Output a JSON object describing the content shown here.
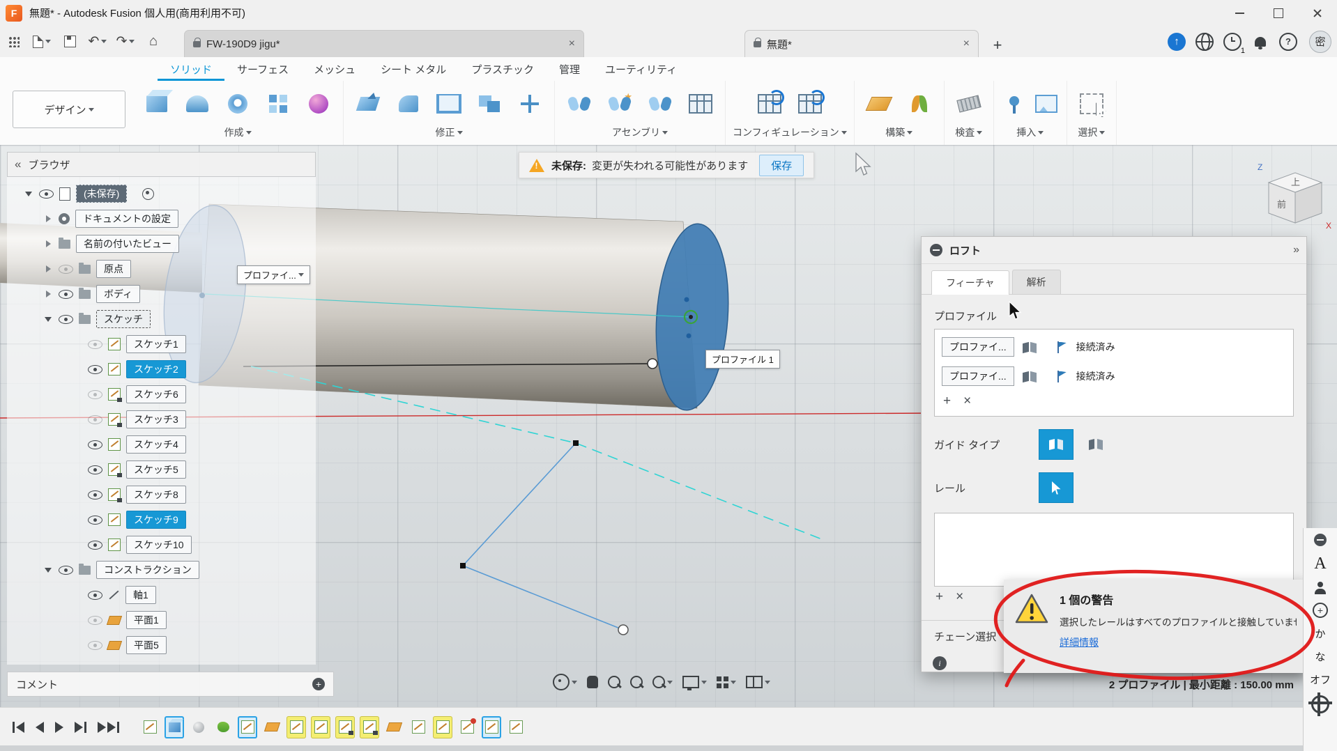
{
  "title_bar": {
    "app_title": "無題* - Autodesk Fusion 個人用(商用利用不可)"
  },
  "quick_toolbar": {
    "left_icons": [
      "app-grid",
      "file-menu",
      "save",
      "undo",
      "redo",
      "home"
    ],
    "doc_tabs": [
      {
        "label": "FW-190D9 jigu*"
      },
      {
        "label": "無題*"
      }
    ],
    "right_icons": [
      "new-tab",
      "job-status",
      "web",
      "time",
      "notifications",
      "help"
    ],
    "notification_count": "1",
    "avatar_initial": "密"
  },
  "ribbon": {
    "workspace_label": "デザイン",
    "tabs": [
      {
        "label": "ソリッド"
      },
      {
        "label": "サーフェス"
      },
      {
        "label": "メッシュ"
      },
      {
        "label": "シート メタル"
      },
      {
        "label": "プラスチック"
      },
      {
        "label": "管理"
      },
      {
        "label": "ユーティリティ"
      }
    ],
    "groups": [
      {
        "label": "作成",
        "tools": [
          "extrude",
          "revolve",
          "hole",
          "pattern",
          "form"
        ]
      },
      {
        "label": "修正",
        "tools": [
          "press-pull",
          "fillet",
          "shell",
          "combine",
          "move"
        ]
      },
      {
        "label": "アセンブリ",
        "tools": [
          "assemble",
          "new-component",
          "joint",
          "parts-table"
        ]
      },
      {
        "label": "コンフィギュレーション",
        "tools": [
          "configure",
          "configuration-table"
        ]
      },
      {
        "label": "構築",
        "tools": [
          "construction-plane",
          "construction-axis"
        ]
      },
      {
        "label": "検査",
        "tools": [
          "measure"
        ]
      },
      {
        "label": "挿入",
        "tools": [
          "insert",
          "canvas"
        ]
      },
      {
        "label": "選択",
        "tools": [
          "select"
        ]
      }
    ]
  },
  "unsaved_bar": {
    "label": "未保存:",
    "message": "変更が失われる可能性があります",
    "save_button": "保存"
  },
  "browser": {
    "title": "ブラウザ",
    "items": [
      {
        "label": "(未保存)"
      },
      {
        "label": "ドキュメントの設定"
      },
      {
        "label": "名前の付いたビュー"
      },
      {
        "label": "原点"
      },
      {
        "label": "ボディ"
      },
      {
        "label": "スケッチ"
      },
      {
        "label": "スケッチ1"
      },
      {
        "label": "スケッチ2"
      },
      {
        "label": "スケッチ6"
      },
      {
        "label": "スケッチ3"
      },
      {
        "label": "スケッチ4"
      },
      {
        "label": "スケッチ5"
      },
      {
        "label": "スケッチ8"
      },
      {
        "label": "スケッチ9"
      },
      {
        "label": "スケッチ10"
      },
      {
        "label": "コンストラクション"
      },
      {
        "label": "軸1"
      },
      {
        "label": "平面1"
      },
      {
        "label": "平面5"
      }
    ]
  },
  "viewport": {
    "profile_dropdown_label": "プロファイ...",
    "profile_tag_label": "プロファイル 1",
    "viewcube_top": "上",
    "viewcube_front": "前"
  },
  "loft_dialog": {
    "title": "ロフト",
    "tab_feature": "フィーチャ",
    "tab_analysis": "解析",
    "profiles_section": "プロファイル",
    "profile_rows": [
      {
        "name": "プロファイ...",
        "status": "接続済み"
      },
      {
        "name": "プロファイ...",
        "status": "接続済み"
      }
    ],
    "guide_type_label": "ガイド タイプ",
    "rail_label": "レール",
    "chain_select_label": "チェーン選択",
    "warning": {
      "title": "1 個の警告",
      "message": "選択したレールはすべてのプロファイルと接触していません。",
      "details_link": "詳細情報"
    }
  },
  "status_bar": {
    "comment_label": "コメント",
    "selection_info": "2 プロファイル | 最小距離 : 150.00 mm"
  },
  "timeline": {
    "playback_icons": [
      "go-to-start",
      "step-back",
      "play",
      "step-forward",
      "go-to-end"
    ],
    "items": [
      "sketch",
      "body",
      "sphere",
      "loft",
      "sketch-selected",
      "plane",
      "sketch-highlight",
      "sketch-highlight",
      "sketch-highlight-lock",
      "sketch-highlight-lock",
      "plane",
      "sketch",
      "sketch-highlight",
      "sketch-suppressed",
      "sketch-selected",
      "sketch"
    ]
  },
  "nav_bar": {
    "icons": [
      "orbit",
      "pan",
      "zoom",
      "fit",
      "zoom-window",
      "display-settings",
      "grid-settings",
      "viewports"
    ]
  },
  "ime_bar": {
    "mode_letter": "A",
    "kana": "か",
    "na": "な",
    "off": "オフ"
  }
}
